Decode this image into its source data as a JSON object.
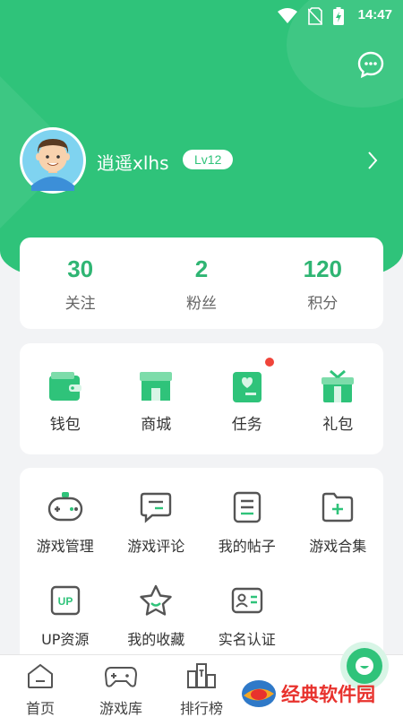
{
  "status": {
    "time": "14:47"
  },
  "profile": {
    "username": "逍遥xlhs",
    "level": "Lv12"
  },
  "stats": [
    {
      "value": "30",
      "label": "关注"
    },
    {
      "value": "2",
      "label": "粉丝"
    },
    {
      "value": "120",
      "label": "积分"
    }
  ],
  "quick": [
    {
      "label": "钱包",
      "icon": "wallet-icon"
    },
    {
      "label": "商城",
      "icon": "shop-icon"
    },
    {
      "label": "任务",
      "icon": "task-icon"
    },
    {
      "label": "礼包",
      "icon": "gift-icon"
    }
  ],
  "tools": [
    {
      "label": "游戏管理",
      "icon": "gamepad-icon"
    },
    {
      "label": "游戏评论",
      "icon": "comment-icon"
    },
    {
      "label": "我的帖子",
      "icon": "post-icon"
    },
    {
      "label": "游戏合集",
      "icon": "folder-add-icon"
    },
    {
      "label": "UP资源",
      "icon": "up-icon",
      "badge": "UP"
    },
    {
      "label": "我的收藏",
      "icon": "star-icon"
    },
    {
      "label": "实名认证",
      "icon": "id-card-icon"
    }
  ],
  "tabs": [
    {
      "label": "首页"
    },
    {
      "label": "游戏库"
    },
    {
      "label": "排行榜"
    }
  ],
  "watermark": {
    "text": "经典软件园"
  },
  "colors": {
    "primary": "#2fc37a",
    "stat_value": "#2fb573",
    "badge_dot": "#f0443a",
    "watermark": "#e8322d"
  }
}
